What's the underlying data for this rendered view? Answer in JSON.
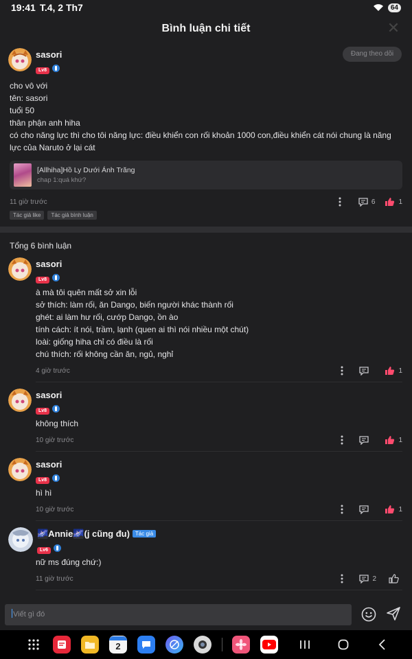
{
  "status": {
    "time": "19:41",
    "date": "T.4, 2 Th7",
    "battery": "64"
  },
  "header": {
    "title": "Bình luận chi tiết"
  },
  "post": {
    "username": "sasori",
    "level": "Lv8",
    "follow_label": "Đang theo dõi",
    "lines": [
      "cho vô với",
      "tên: sasori",
      "tuổi 50",
      "thân phận anh hiha",
      "có cho năng lực thì cho tôi năng lực: điều khiển con rối khoản 1000 con,điều khiển cát nói chung là năng lực của Naruto ở lại cát"
    ],
    "manga": {
      "title": "[Allhiha]Hồ Ly Dưới Ánh Trăng",
      "chapter": "chap 1:quá khứ?"
    },
    "time": "11 giờ trước",
    "comment_count": "6",
    "like_count": "1",
    "tags": [
      "Tác giả like",
      "Tác giả bình luận"
    ]
  },
  "comments_total": "Tổng 6 bình luận",
  "comments": [
    {
      "username": "sasori",
      "level": "Lv8",
      "lines": [
        "à mà tôi quên mất sở xin lỗi",
        "sở thích: làm rối, ăn Dango, biến người khác thành rối",
        "ghét: ai làm hư rối, cướp Dango, ồn ào",
        "tính cách: ít nói, trầm, lạnh (quen ai thì nói nhiều một chút)",
        "loài: giống hiha chỉ có điều là rối",
        "chú thích: rối không cần ăn, ngủ, nghỉ"
      ],
      "time": "4 giờ trước",
      "reply_count": "",
      "like_count": "1"
    },
    {
      "username": "sasori",
      "level": "Lv8",
      "lines": [
        "không thích"
      ],
      "time": "10 giờ trước",
      "reply_count": "",
      "like_count": "1"
    },
    {
      "username": "sasori",
      "level": "Lv8",
      "lines": [
        "hì hì"
      ],
      "time": "10 giờ trước",
      "reply_count": "",
      "like_count": "1"
    },
    {
      "username": "🌌Annie🌌(j cũng đu)",
      "level": "Lv6",
      "author_tag": "Tác giả",
      "lines": [
        "nữ ms đúng chứ:)"
      ],
      "time": "11 giờ trước",
      "reply_count": "2",
      "like_count": ""
    }
  ],
  "input": {
    "placeholder": "Viết gì đó"
  },
  "dock": {
    "calendar_day": "2",
    "apps": [
      "apps-grid-icon",
      "notes-app-icon",
      "files-app-icon",
      "calendar-app-icon",
      "messages-app-icon",
      "browser-app-icon",
      "camera-app-icon",
      "photos-app-icon",
      "youtube-app-icon"
    ]
  },
  "colors": {
    "accent_like": "#ff4b6e",
    "level_badge": "#e8324a",
    "author_tag": "#3a8be6"
  }
}
